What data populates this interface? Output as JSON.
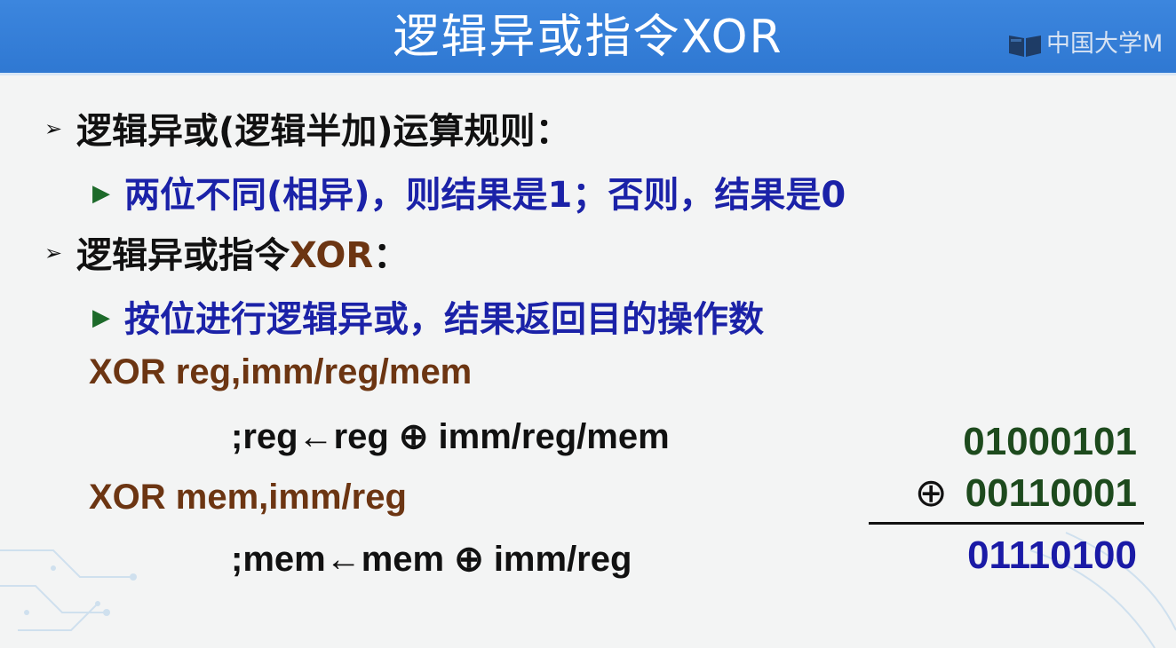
{
  "header": {
    "title": "逻辑异或指令XOR",
    "logo_text": "中国大学M"
  },
  "bullets": {
    "rule_heading_prefix": "逻辑异或(逻辑半加)运算规则",
    "rule_heading_colon": "：",
    "rule_detail": "两位不同(相异)，则结果是1；否则，结果是0",
    "instr_heading_prefix": "逻辑异或指令",
    "instr_heading_keyword": "XOR",
    "instr_heading_colon": "：",
    "instr_detail": "按位进行逻辑异或，结果返回目的操作数"
  },
  "syntax": {
    "form1": "XOR reg,imm/reg/mem",
    "form1_comment": ";reg←reg ⊕ imm/reg/mem",
    "form2": "XOR mem,imm/reg",
    "form2_comment": ";mem←mem ⊕ imm/reg"
  },
  "example": {
    "operand1": "01000101",
    "operator": "⊕",
    "operand2": "00110001",
    "result": "01110100"
  },
  "colors": {
    "header_blue": "#3080d8",
    "detail_blue": "#1b22a8",
    "instruction_brown": "#6c3512",
    "binary_green": "#1d4a1d",
    "result_blue": "#1a1aa6"
  }
}
